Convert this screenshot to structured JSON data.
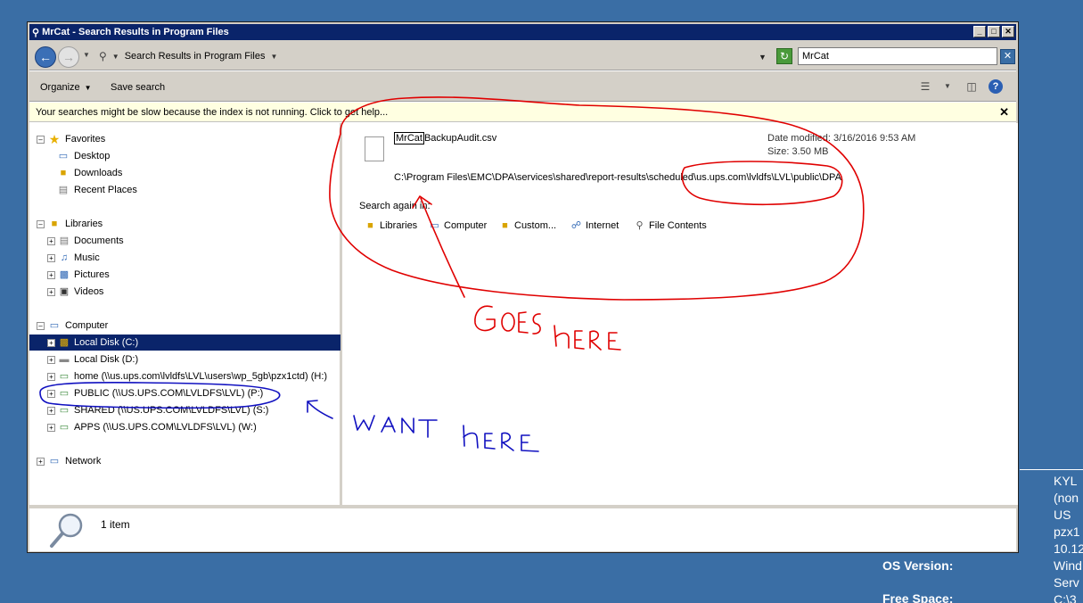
{
  "window": {
    "title": "MrCat - Search Results in Program Files"
  },
  "window_controls": {
    "minimize": "_",
    "maximize": "□",
    "close": "✕"
  },
  "address": {
    "breadcrumb": "Search Results in Program Files",
    "search_value": "MrCat"
  },
  "toolbar": {
    "organize_label": "Organize",
    "save_search_label": "Save search"
  },
  "infobar": {
    "message": "Your searches might be slow because the index is not running.  Click to get help...",
    "close": "✕"
  },
  "nav": {
    "favorites": {
      "label": "Favorites",
      "items": [
        "Desktop",
        "Downloads",
        "Recent Places"
      ]
    },
    "libraries": {
      "label": "Libraries",
      "items": [
        "Documents",
        "Music",
        "Pictures",
        "Videos"
      ]
    },
    "computer": {
      "label": "Computer",
      "items": [
        "Local Disk (C:)",
        "Local Disk (D:)",
        "home (\\\\us.ups.com\\lvldfs\\LVL\\users\\wp_5gb\\pzx1ctd) (H:)",
        "PUBLIC (\\\\US.UPS.COM\\LVLDFS\\LVL) (P:)",
        "SHARED (\\\\US.UPS.COM\\LVLDFS\\LVL) (S:)",
        "APPS (\\\\US.UPS.COM\\LVLDFS\\LVL) (W:)"
      ]
    },
    "network": {
      "label": "Network"
    }
  },
  "result": {
    "name_highlight": "MrCat",
    "name_rest": "BackupAudit.csv",
    "date_modified": "Date modified: 3/16/2016 9:53 AM",
    "size": "Size: 3.50 MB",
    "path": "C:\\Program Files\\EMC\\DPA\\services\\shared\\report-results\\scheduled\\us.ups.com\\lvldfs\\LVL\\public\\DPA"
  },
  "search_again": {
    "label": "Search again in:",
    "options": [
      "Libraries",
      "Computer",
      "Custom...",
      "Internet",
      "File Contents"
    ]
  },
  "details": {
    "count": "1 item"
  },
  "desktop_info": {
    "values": [
      "KYL",
      "(non",
      "US",
      "pzx1",
      "10.12",
      "Wind",
      "Serv",
      "C:\\3"
    ],
    "os_version_label": "OS Version:",
    "free_space_label": "Free Space:"
  },
  "annotations": {
    "goes_here": "GOES HERE",
    "want_here": "WANT HERE"
  },
  "colors": {
    "title_bar": "#0a246a",
    "selection": "#0a246a",
    "desktop": "#3a6ea5",
    "annotation_red": "#e00000",
    "annotation_blue": "#1010c0"
  }
}
